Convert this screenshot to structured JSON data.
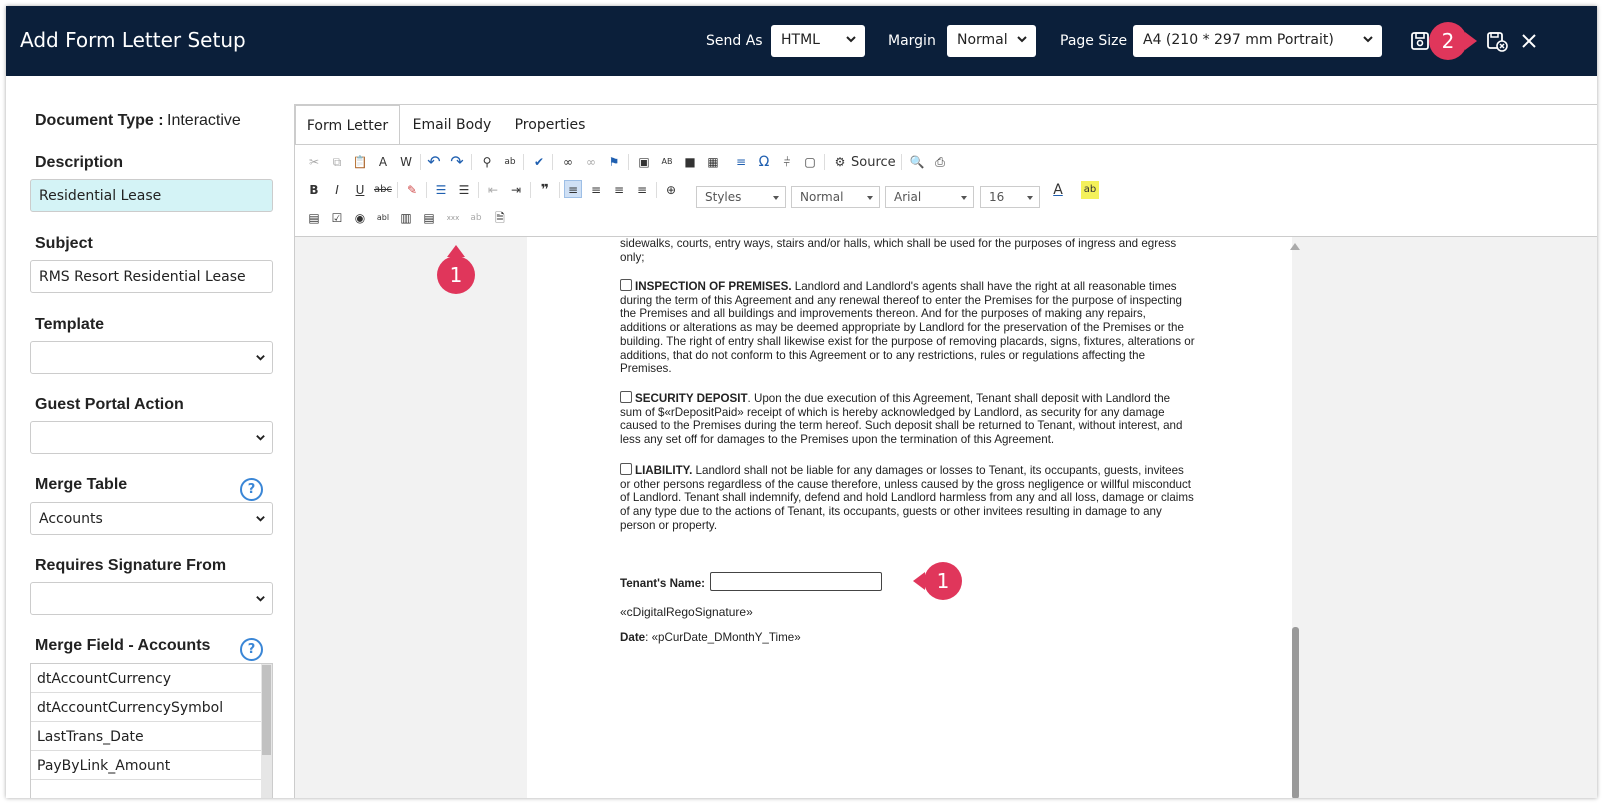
{
  "header": {
    "title": "Add Form Letter Setup",
    "send_as_label": "Send As",
    "send_as_value": "HTML",
    "margin_label": "Margin",
    "margin_value": "Normal",
    "page_size_label": "Page Size",
    "page_size_value": "A4 (210 * 297 mm Portrait)",
    "bg_color": "#0b1f3a"
  },
  "annotations": {
    "badge_toolbar": "1",
    "badge_signature": "1",
    "badge_save_close": "2",
    "color": "#e0365b"
  },
  "left": {
    "document_type_label": "Document Type :",
    "document_type_value": "Interactive",
    "description_label": "Description",
    "description_value": "Residential Lease",
    "subject_label": "Subject",
    "subject_value": "RMS Resort Residential Lease",
    "template_label": "Template",
    "template_value": "",
    "guest_portal_label": "Guest Portal Action",
    "guest_portal_value": "",
    "merge_table_label": "Merge Table",
    "merge_table_value": "Accounts",
    "requires_signature_label": "Requires Signature From",
    "requires_signature_value": "",
    "merge_field_label": "Merge Field - Accounts",
    "help_glyph": "?",
    "merge_fields": [
      "dtAccountCurrency",
      "dtAccountCurrencySymbol",
      "LastTrans_Date",
      "PayByLink_Amount"
    ]
  },
  "tabs": [
    "Form Letter",
    "Email Body",
    "Properties"
  ],
  "toolbar": {
    "source_label": "Source",
    "styles_label": "Styles",
    "format_label": "Normal",
    "font_label": "Arial",
    "size_label": "16",
    "icons": [
      "cut-icon",
      "copy-icon",
      "paste-icon",
      "paste-text-icon",
      "paste-word-icon",
      "undo-icon",
      "redo-icon",
      "find-icon",
      "replace-icon",
      "spellcheck-icon",
      "link-icon",
      "unlink-icon",
      "anchor-icon",
      "image-icon",
      "template-icon",
      "flash-icon",
      "table-icon",
      "hr-icon",
      "special-char-icon",
      "page-break-icon",
      "iframe-icon",
      "source-icon",
      "preview-icon",
      "print-icon",
      "bold-icon",
      "italic-icon",
      "underline-icon",
      "strike-icon",
      "remove-format-icon",
      "numbered-list-icon",
      "bulleted-list-icon",
      "outdent-icon",
      "indent-icon",
      "blockquote-icon",
      "align-left-icon",
      "align-center-icon",
      "align-right-icon",
      "justify-icon",
      "language-icon",
      "text-color-icon",
      "bg-color-icon",
      "form-icon",
      "checkbox-icon",
      "radio-icon",
      "textfield-icon",
      "textarea-icon",
      "select-icon",
      "button-icon",
      "hidden-field-icon",
      "signature-icon"
    ]
  },
  "document": {
    "para_intro": "sidewalks, courts, entry ways, stairs and/or halls, which shall be used for the purposes of ingress and egress only;",
    "para1_heading": "INSPECTION OF PREMISES.",
    "para1_body": " Landlord and Landlord's agents shall have the right at all reasonable times during the term of this Agreement and any renewal thereof to enter the Premises for the purpose of inspecting the Premises and all buildings and improvements thereon. And for the purposes of making any repairs, additions or alterations as may be deemed appropriate by Landlord for the preservation of the Premises or the building. The right of entry shall likewise exist for the purpose of removing placards, signs, fixtures, alterations or additions, that do not conform to this Agreement or to any restrictions, rules or regulations affecting the Premises.",
    "para2_heading": "SECURITY DEPOSIT",
    "para2_body_a": ". Upon the due execution of this Agreement, Tenant shall deposit with Landlord the sum of ",
    "para2_field": "$«rDepositPaid»",
    "para2_body_b": " receipt of which is hereby acknowledged by Landlord, as security for any damage caused to the Premises during the term hereof. Such deposit shall be returned to Tenant, without interest, and less any set off for damages to the Premises upon the termination of this Agreement.",
    "para3_heading": "LIABILITY.",
    "para3_body": " Landlord shall not be liable for any damages or losses to Tenant, its occupants, guests, invitees or other persons regardless of the cause therefore, unless caused by the gross negligence or willful misconduct of Landlord. Tenant shall indemnify, defend and hold Landlord harmless from any and all loss, damage or claims of any type due to the actions of Tenant, its occupants, guests or other invitees resulting in damage to any person or property.",
    "tenant_name_label": "Tenant's Name:",
    "tenant_name_value": "",
    "signature_field": "«cDigitalRegoSignature»",
    "date_label": "Date",
    "date_field": ": «pCurDate_DMonthY_Time»"
  }
}
